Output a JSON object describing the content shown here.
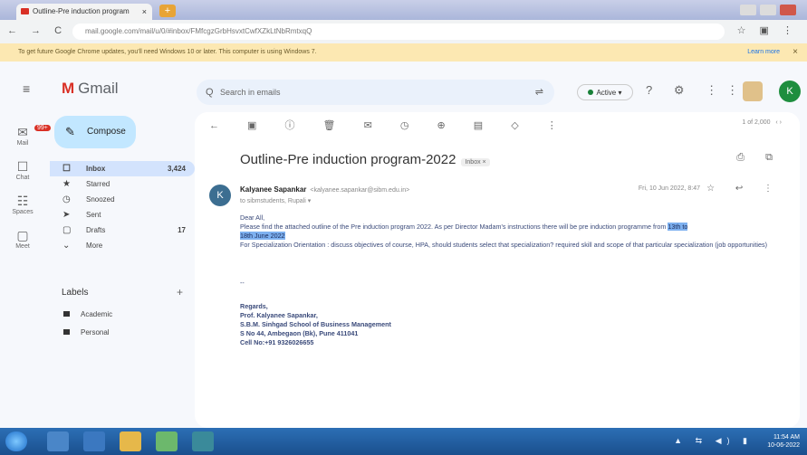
{
  "browser": {
    "tab_title": "Outline-Pre induction program",
    "tab_close": "×",
    "new_tab": "+",
    "nav": "← → C",
    "url": "mail.google.com/mail/u/0/#inbox/FMfcgzGrbHsvxtCwfXZkLtNbRmtxqQ",
    "infobar_text": "To get future Google Chrome updates, you'll need Windows 10 or later. This computer is using Windows 7.",
    "infobar_link": "Learn more",
    "infobar_close": "×"
  },
  "gmail": {
    "menu_icon": "≡",
    "logo_m": "M",
    "logo_text": "Gmail",
    "search_placeholder": "Search in emails",
    "search_icon": "Q",
    "filter_icon": "⇌",
    "status": "Active",
    "header_icons": "? ⚙ ⋮⋮⋮",
    "avatar_letter": "K",
    "compose_icon": "✎",
    "compose": "Compose",
    "rail": [
      {
        "glyph": "✉",
        "label": "Mail",
        "badge": "99+"
      },
      {
        "glyph": "☐",
        "label": "Chat"
      },
      {
        "glyph": "☷",
        "label": "Spaces"
      },
      {
        "glyph": "▢",
        "label": "Meet"
      }
    ],
    "folders": [
      {
        "icon": "☐",
        "label": "Inbox",
        "count": "3,424",
        "selected": true
      },
      {
        "icon": "★",
        "label": "Starred"
      },
      {
        "icon": "◷",
        "label": "Snoozed"
      },
      {
        "icon": "➤",
        "label": "Sent"
      },
      {
        "icon": "▢",
        "label": "Drafts",
        "count": "17"
      },
      {
        "icon": "⌄",
        "label": "More"
      }
    ],
    "labels_title": "Labels",
    "labels_add": "+",
    "labels": [
      "Academic",
      "Personal"
    ]
  },
  "email": {
    "toolbar": "← ▣ ⓘ 🗑 ✉ ◷ ⊕ ▤ ◇ ⋮",
    "pager": "1 of 2,000",
    "pager_nav": "‹ ›",
    "subject": "Outline-Pre induction program-2022",
    "tag": "Inbox ×",
    "subject_icons": "⎙ ⧉",
    "sender_initial": "K",
    "sender_name": "Kalyanee Sapankar",
    "sender_email": "<kalyanee.sapankar@sibm.edu.in>",
    "to": "to sibmstudents, Rupali ▾",
    "date": "Fri, 10 Jun 2022, 8:47",
    "message_icons": "☆ ↩ ⋮",
    "greeting": "Dear All,",
    "line1": "Please find the attached outline of the Pre induction program 2022. As per Director Madam's instructions there will be pre induction programme from",
    "hl1": "13th to",
    "hl2": "18th June 2022",
    "line3": "For Specialization Orientation : discuss objectives of course, HPA, should students select that specialization? required skill and scope of that particular specialization (job opportunities)",
    "dashes": "--",
    "signature": [
      "Regards,",
      "Prof. Kalyanee Sapankar,",
      "S.B.M. Sinhgad School of Business Management",
      "S No 44, Ambegaon (Bk), Pune 411041",
      "Cell No:+91 9326026655"
    ]
  },
  "taskbar": {
    "tray": "▲ ⇆ ◀) ▮",
    "time": "11:54 AM",
    "date": "10-06-2022"
  }
}
